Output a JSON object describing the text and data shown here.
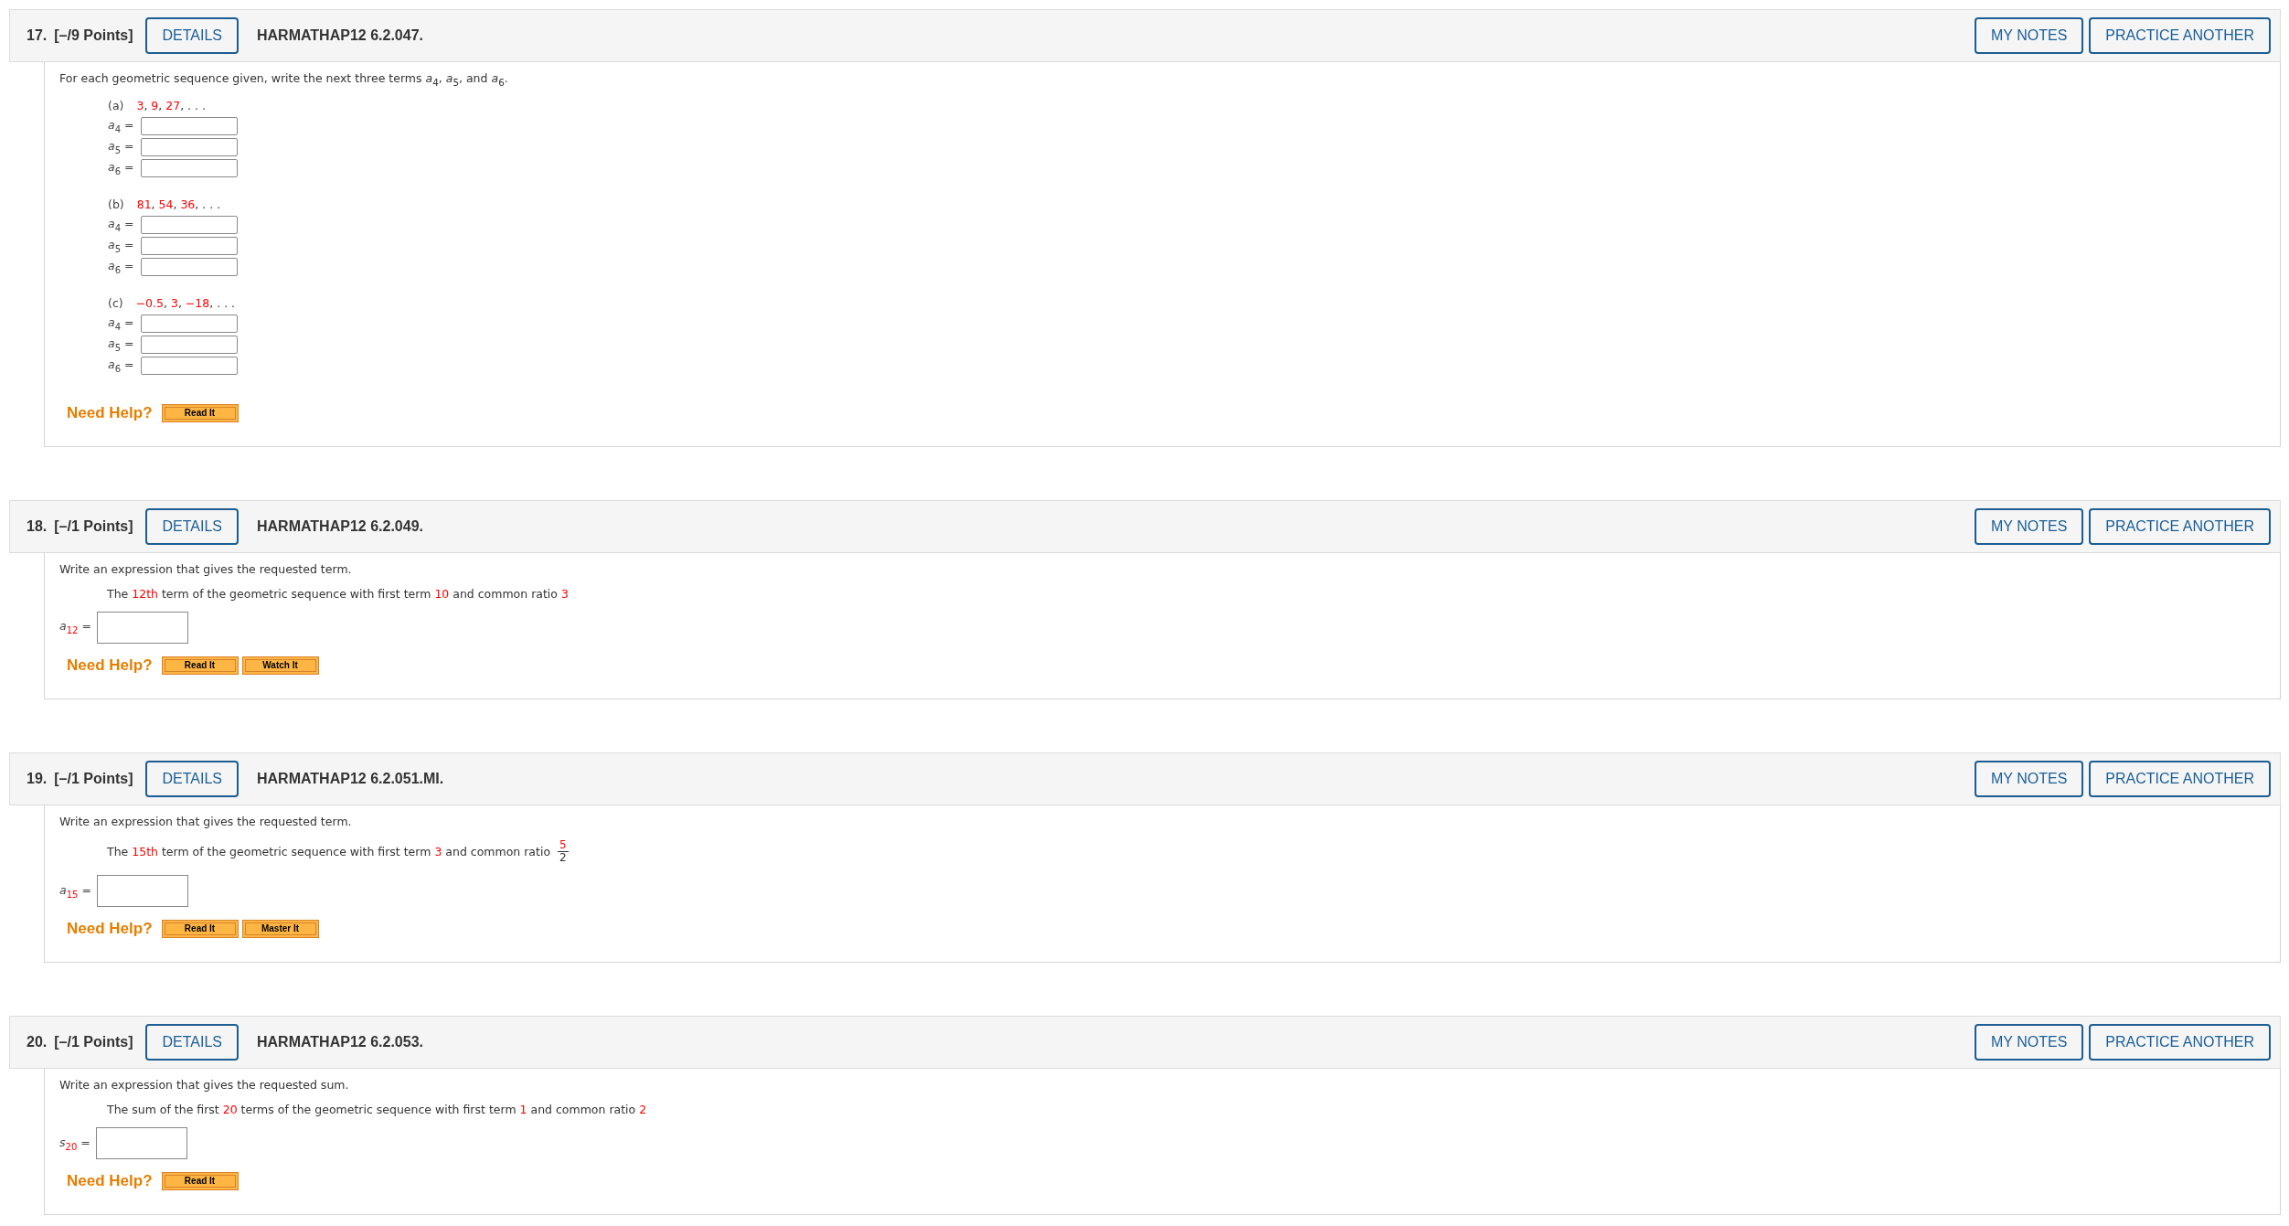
{
  "questions": [
    {
      "number": "17.",
      "points": "[–/9 Points]",
      "details": "DETAILS",
      "code": "HARMATHAP12 6.2.047.",
      "actions": [
        "MY NOTES",
        "PRACTICE ANOTHER"
      ],
      "intro": "For each geometric sequence given, write the next three terms *a*$_{4}$, *a*$_{5}$, and *a*$_{6}$.",
      "parts": [
        {
          "label": "(a)",
          "segments": [
            {
              "kind": "text",
              "text": "3",
              "highlight": true
            },
            {
              "kind": "text",
              "text": ", ",
              "highlight": false
            },
            {
              "kind": "text",
              "text": "9",
              "highlight": true
            },
            {
              "kind": "text",
              "text": ", ",
              "highlight": false
            },
            {
              "kind": "text",
              "text": "27",
              "highlight": true
            },
            {
              "kind": "text",
              "text": ", . . .",
              "highlight": false
            }
          ],
          "answers": [
            {
              "variable": "a",
              "index": "4",
              "index_highlight": false,
              "sign": "="
            },
            {
              "variable": "a",
              "index": "5",
              "index_highlight": false,
              "sign": "="
            },
            {
              "variable": "a",
              "index": "6",
              "index_highlight": false,
              "sign": "="
            }
          ]
        },
        {
          "label": "(b)",
          "segments": [
            {
              "kind": "text",
              "text": "81",
              "highlight": true
            },
            {
              "kind": "text",
              "text": ", ",
              "highlight": false
            },
            {
              "kind": "text",
              "text": "54",
              "highlight": true
            },
            {
              "kind": "text",
              "text": ", ",
              "highlight": false
            },
            {
              "kind": "text",
              "text": "36",
              "highlight": true
            },
            {
              "kind": "text",
              "text": ", . . .",
              "highlight": false
            }
          ],
          "answers": [
            {
              "variable": "a",
              "index": "4",
              "index_highlight": false,
              "sign": "="
            },
            {
              "variable": "a",
              "index": "5",
              "index_highlight": false,
              "sign": "="
            },
            {
              "variable": "a",
              "index": "6",
              "index_highlight": false,
              "sign": "="
            }
          ]
        },
        {
          "label": "(c)",
          "segments": [
            {
              "kind": "text",
              "text": "−0.5",
              "highlight": true
            },
            {
              "kind": "text",
              "text": ", ",
              "highlight": false
            },
            {
              "kind": "text",
              "text": "3",
              "highlight": true
            },
            {
              "kind": "text",
              "text": ", ",
              "highlight": false
            },
            {
              "kind": "text",
              "text": "−18",
              "highlight": true
            },
            {
              "kind": "text",
              "text": ", . . .",
              "highlight": false
            }
          ],
          "answers": [
            {
              "variable": "a",
              "index": "4",
              "index_highlight": false,
              "sign": "="
            },
            {
              "variable": "a",
              "index": "5",
              "index_highlight": false,
              "sign": "="
            },
            {
              "variable": "a",
              "index": "6",
              "index_highlight": false,
              "sign": "="
            }
          ]
        }
      ],
      "help": {
        "label": "Need Help?",
        "buttons": [
          "Read It"
        ]
      }
    },
    {
      "number": "18.",
      "points": "[–/1 Points]",
      "details": "DETAILS",
      "code": "HARMATHAP12 6.2.049.",
      "actions": [
        "MY NOTES",
        "PRACTICE ANOTHER"
      ],
      "intro": "Write an expression that gives the requested term.",
      "statement": [
        {
          "kind": "text",
          "text": "The ",
          "highlight": false
        },
        {
          "kind": "text",
          "text": "12th",
          "highlight": true
        },
        {
          "kind": "text",
          "text": " term of the geometric sequence with first term ",
          "highlight": false
        },
        {
          "kind": "text",
          "text": "10",
          "highlight": true
        },
        {
          "kind": "text",
          "text": " and common ratio ",
          "highlight": false
        },
        {
          "kind": "text",
          "text": "3",
          "highlight": true
        }
      ],
      "answers": [
        {
          "variable": "a",
          "index": "12",
          "index_highlight": true,
          "sign": "="
        }
      ],
      "help": {
        "label": "Need Help?",
        "buttons": [
          "Read It",
          "Watch It"
        ]
      }
    },
    {
      "number": "19.",
      "points": "[–/1 Points]",
      "details": "DETAILS",
      "code": "HARMATHAP12 6.2.051.MI.",
      "actions": [
        "MY NOTES",
        "PRACTICE ANOTHER"
      ],
      "intro": "Write an expression that gives the requested term.",
      "statement": [
        {
          "kind": "text",
          "text": "The ",
          "highlight": false
        },
        {
          "kind": "text",
          "text": "15th",
          "highlight": true
        },
        {
          "kind": "text",
          "text": " term of the geometric sequence with first term ",
          "highlight": false
        },
        {
          "kind": "text",
          "text": "3",
          "highlight": true
        },
        {
          "kind": "text",
          "text": " and common ratio ",
          "highlight": false
        },
        {
          "kind": "fraction",
          "numerator": "5",
          "denominator": "2",
          "highlight": true
        }
      ],
      "answers": [
        {
          "variable": "a",
          "index": "15",
          "index_highlight": true,
          "sign": "="
        }
      ],
      "help": {
        "label": "Need Help?",
        "buttons": [
          "Read It",
          "Master It"
        ]
      }
    },
    {
      "number": "20.",
      "points": "[–/1 Points]",
      "details": "DETAILS",
      "code": "HARMATHAP12 6.2.053.",
      "actions": [
        "MY NOTES",
        "PRACTICE ANOTHER"
      ],
      "intro": "Write an expression that gives the requested sum.",
      "statement": [
        {
          "kind": "text",
          "text": "The sum of the first ",
          "highlight": false
        },
        {
          "kind": "text",
          "text": "20",
          "highlight": true
        },
        {
          "kind": "text",
          "text": " terms of the geometric sequence with first term ",
          "highlight": false
        },
        {
          "kind": "text",
          "text": "1",
          "highlight": true
        },
        {
          "kind": "text",
          "text": " and common ratio ",
          "highlight": false
        },
        {
          "kind": "text",
          "text": "2",
          "highlight": true
        }
      ],
      "answers": [
        {
          "variable": "s",
          "index": "20",
          "index_highlight": true,
          "sign": "="
        }
      ],
      "help": {
        "label": "Need Help?",
        "buttons": [
          "Read It"
        ]
      }
    }
  ]
}
